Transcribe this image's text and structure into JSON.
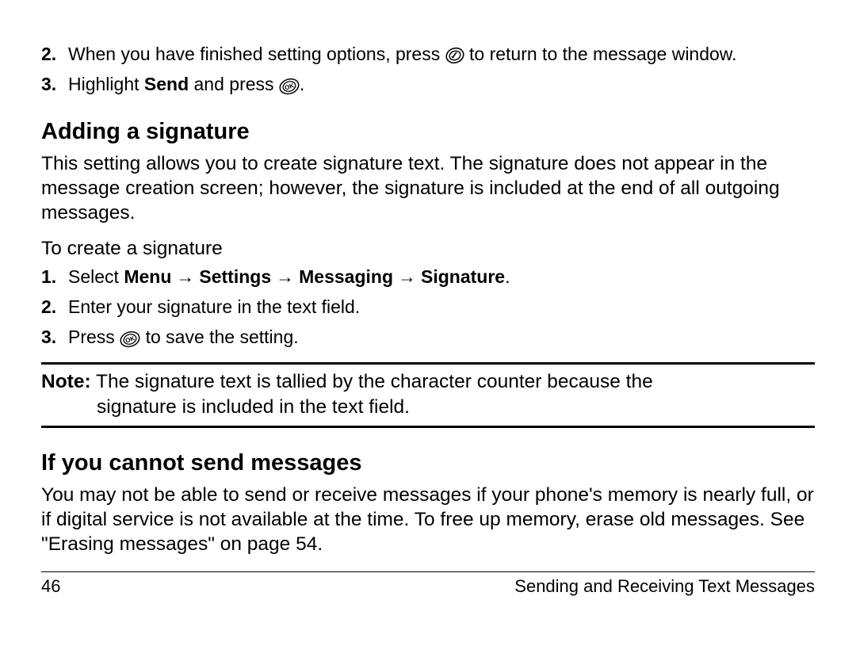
{
  "step2": {
    "num": "2.",
    "pre": "When you have finished setting options, press ",
    "post": " to return to the message window."
  },
  "step3": {
    "num": "3.",
    "pre": "Highlight ",
    "bold": "Send",
    "mid": " and press ",
    "post": "."
  },
  "heading1": "Adding a signature",
  "sig_intro": "This setting allows you to create signature text. The signature does not appear in the message creation screen; however, the signature is included at the end of all outgoing messages.",
  "sig_lead": "To create a signature",
  "sig1": {
    "num": "1.",
    "pre": "Select ",
    "m1": "Menu",
    "m2": "Settings",
    "m3": "Messaging",
    "m4": "Signature",
    "post": "."
  },
  "sig2": {
    "num": "2.",
    "text": "Enter your signature in the text field."
  },
  "sig3": {
    "num": "3.",
    "pre": "Press ",
    "post": " to save the setting."
  },
  "note": {
    "label": "Note:",
    "line1": " The signature text is tallied by the character counter because the",
    "line2": "signature is included in the text field."
  },
  "heading2": "If you cannot send messages",
  "fail_para": "You may not be able to send or receive messages if your phone's memory is nearly full, or if digital service is not available at the time. To free up memory, erase old messages. See \"Erasing messages\" on page 54.",
  "footer": {
    "page": "46",
    "title": "Sending and Receiving Text Messages"
  },
  "arrow": "→"
}
